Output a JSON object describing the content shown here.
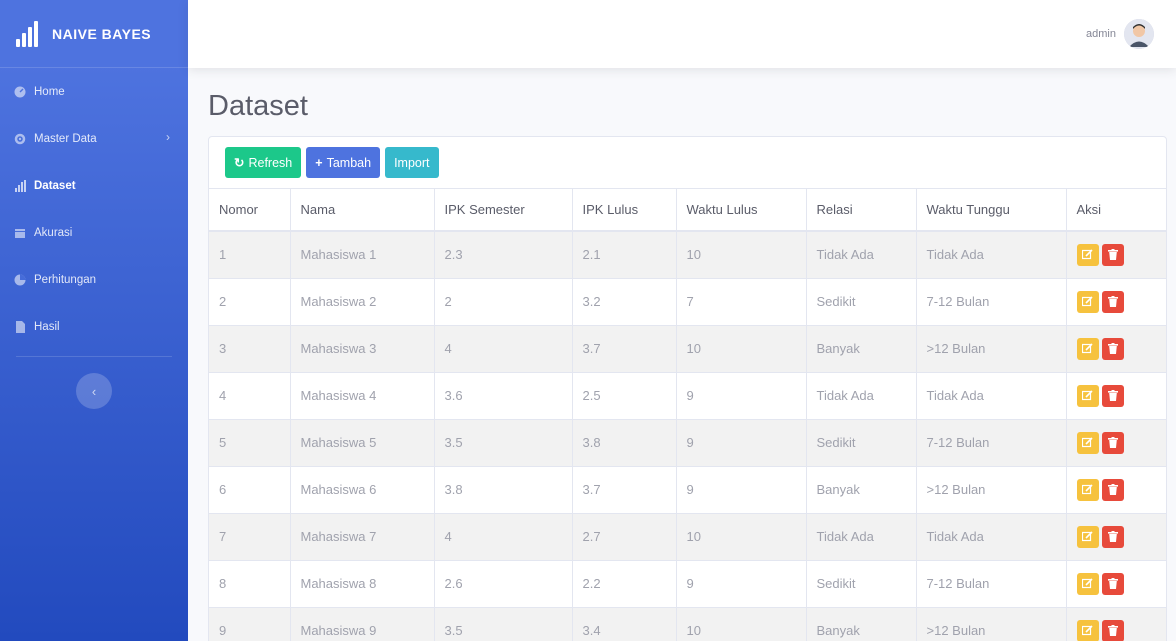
{
  "brand": {
    "name": "NAIVE BAYES"
  },
  "sidebar": {
    "items": [
      {
        "label": "Home",
        "icon": "dashboard-icon"
      },
      {
        "label": "Master Data",
        "icon": "cog-icon"
      },
      {
        "label": "Dataset",
        "icon": "bar-chart-icon"
      },
      {
        "label": "Akurasi",
        "icon": "calendar-icon"
      },
      {
        "label": "Perhitungan",
        "icon": "pie-chart-icon"
      },
      {
        "label": "Hasil",
        "icon": "file-icon"
      }
    ]
  },
  "topbar": {
    "user": "admin"
  },
  "page": {
    "title": "Dataset"
  },
  "toolbar": {
    "refresh": "Refresh",
    "add": "Tambah",
    "import": "Import"
  },
  "table": {
    "headers": [
      "Nomor",
      "Nama",
      "IPK Semester",
      "IPK Lulus",
      "Waktu Lulus",
      "Relasi",
      "Waktu Tunggu",
      "Aksi"
    ],
    "rows": [
      [
        "1",
        "Mahasiswa 1",
        "2.3",
        "2.1",
        "10",
        "Tidak Ada",
        "Tidak Ada"
      ],
      [
        "2",
        "Mahasiswa 2",
        "2",
        "3.2",
        "7",
        "Sedikit",
        "7-12 Bulan"
      ],
      [
        "3",
        "Mahasiswa 3",
        "4",
        "3.7",
        "10",
        "Banyak",
        ">12 Bulan"
      ],
      [
        "4",
        "Mahasiswa 4",
        "3.6",
        "2.5",
        "9",
        "Tidak Ada",
        "Tidak Ada"
      ],
      [
        "5",
        "Mahasiswa 5",
        "3.5",
        "3.8",
        "9",
        "Sedikit",
        "7-12 Bulan"
      ],
      [
        "6",
        "Mahasiswa 6",
        "3.8",
        "3.7",
        "9",
        "Banyak",
        ">12 Bulan"
      ],
      [
        "7",
        "Mahasiswa 7",
        "4",
        "2.7",
        "10",
        "Tidak Ada",
        "Tidak Ada"
      ],
      [
        "8",
        "Mahasiswa 8",
        "2.6",
        "2.2",
        "9",
        "Sedikit",
        "7-12 Bulan"
      ],
      [
        "9",
        "Mahasiswa 9",
        "3.5",
        "3.4",
        "10",
        "Banyak",
        ">12 Bulan"
      ]
    ]
  },
  "colors": {
    "sidebar": "#4e73df",
    "success": "#1cc88a",
    "primary": "#4e73df",
    "info": "#36b9cc",
    "warning": "#f6c23e",
    "danger": "#e74a3b"
  }
}
